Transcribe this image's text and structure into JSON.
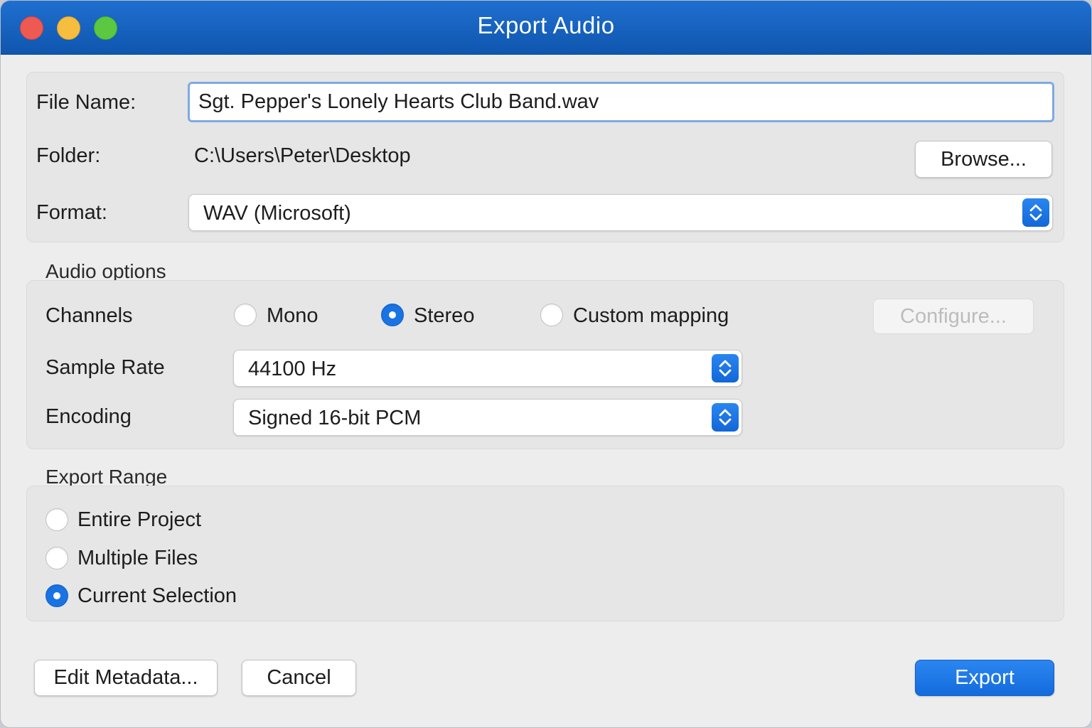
{
  "window": {
    "title": "Export Audio"
  },
  "file": {
    "name_label": "File Name:",
    "name_value": "Sgt. Pepper's Lonely Hearts Club Band.wav",
    "folder_label": "Folder:",
    "folder_value": "C:\\Users\\Peter\\Desktop",
    "browse_label": "Browse...",
    "format_label": "Format:",
    "format_value": "WAV (Microsoft)"
  },
  "audio_options": {
    "title": "Audio options",
    "channels_label": "Channels",
    "channels": [
      {
        "label": "Mono",
        "selected": false
      },
      {
        "label": "Stereo",
        "selected": true
      },
      {
        "label": "Custom mapping",
        "selected": false
      }
    ],
    "configure_label": "Configure...",
    "sample_rate_label": "Sample Rate",
    "sample_rate_value": "44100 Hz",
    "encoding_label": "Encoding",
    "encoding_value": "Signed 16-bit PCM"
  },
  "export_range": {
    "title": "Export Range",
    "options": [
      {
        "label": "Entire Project",
        "selected": false
      },
      {
        "label": "Multiple Files",
        "selected": false
      },
      {
        "label": "Current Selection",
        "selected": true
      }
    ]
  },
  "footer": {
    "edit_metadata_label": "Edit Metadata...",
    "cancel_label": "Cancel",
    "export_label": "Export"
  },
  "colors": {
    "titlebar": "#1562c2",
    "accent": "#1a73e3"
  }
}
